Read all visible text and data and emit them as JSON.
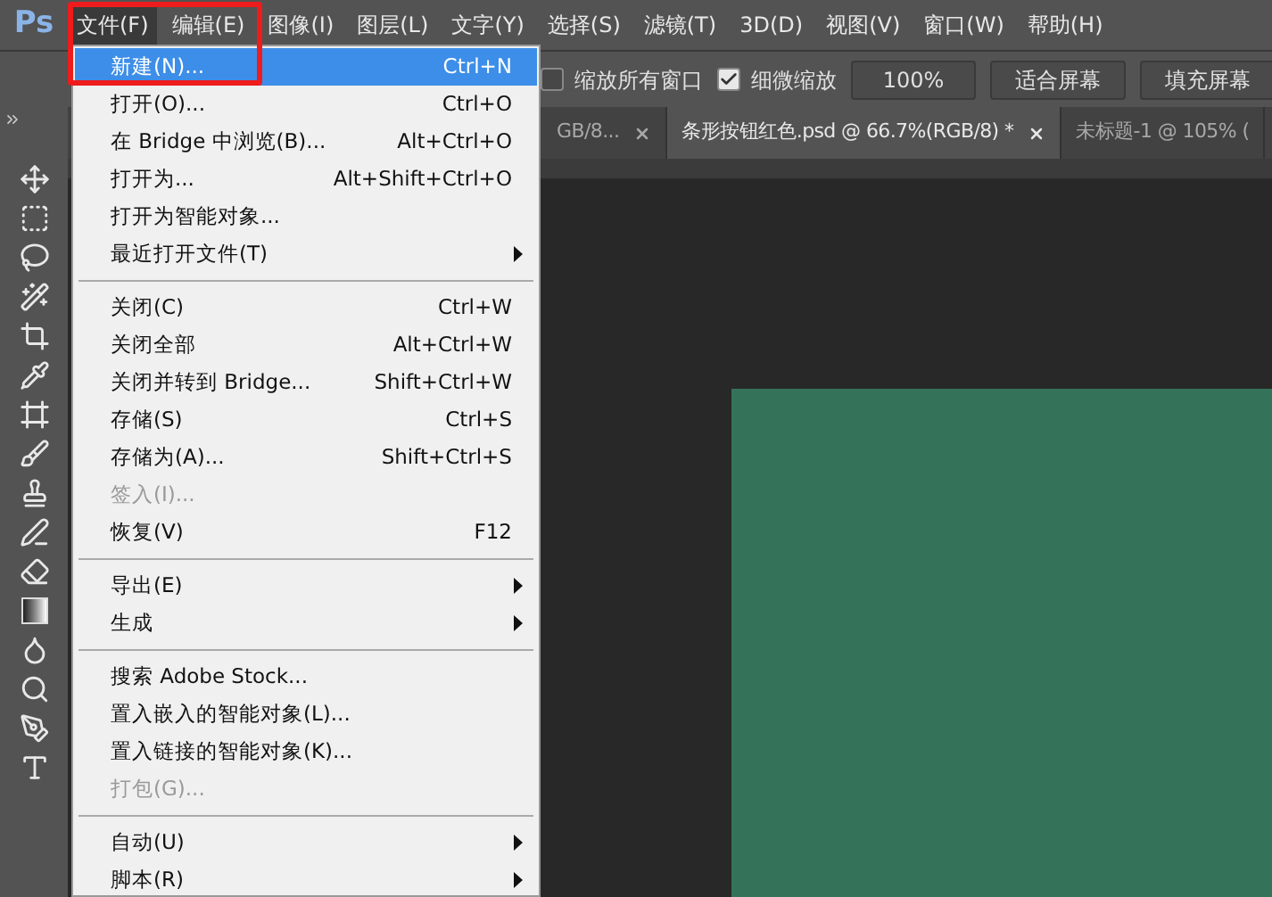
{
  "app": {
    "logo": "Ps"
  },
  "menubar": [
    {
      "label": "文件(F)",
      "selected": true
    },
    {
      "label": "编辑(E)",
      "selected": false
    },
    {
      "label": "图像(I)",
      "selected": false
    },
    {
      "label": "图层(L)",
      "selected": false
    },
    {
      "label": "文字(Y)",
      "selected": false
    },
    {
      "label": "选择(S)",
      "selected": false
    },
    {
      "label": "滤镜(T)",
      "selected": false
    },
    {
      "label": "3D(D)",
      "selected": false
    },
    {
      "label": "视图(V)",
      "selected": false
    },
    {
      "label": "窗口(W)",
      "selected": false
    },
    {
      "label": "帮助(H)",
      "selected": false
    }
  ],
  "options_bar": {
    "checkboxes": [
      {
        "label": "缩放所有窗口",
        "checked": false
      },
      {
        "label": "细微缩放",
        "checked": true
      }
    ],
    "zoom_value": "100%",
    "buttons": [
      "适合屏幕",
      "填充屏幕"
    ]
  },
  "tabs": [
    {
      "label": "GB/8...",
      "selected": false,
      "closable": true
    },
    {
      "label": "条形按钮红色.psd @ 66.7%(RGB/8) *",
      "selected": true,
      "closable": true
    },
    {
      "label": "未标题-1 @ 105% (",
      "selected": false,
      "closable": false
    }
  ],
  "file_menu": [
    [
      {
        "label": "新建(N)...",
        "shortcut": "Ctrl+N",
        "selected": true,
        "disabled": false,
        "submenu": false
      },
      {
        "label": "打开(O)...",
        "shortcut": "Ctrl+O",
        "selected": false,
        "disabled": false,
        "submenu": false
      },
      {
        "label": "在 Bridge 中浏览(B)...",
        "shortcut": "Alt+Ctrl+O",
        "selected": false,
        "disabled": false,
        "submenu": false
      },
      {
        "label": "打开为...",
        "shortcut": "Alt+Shift+Ctrl+O",
        "selected": false,
        "disabled": false,
        "submenu": false
      },
      {
        "label": "打开为智能对象...",
        "selected": false,
        "disabled": false,
        "submenu": false
      },
      {
        "label": "最近打开文件(T)",
        "selected": false,
        "disabled": false,
        "submenu": true
      }
    ],
    [
      {
        "label": "关闭(C)",
        "shortcut": "Ctrl+W",
        "selected": false,
        "disabled": false,
        "submenu": false
      },
      {
        "label": "关闭全部",
        "shortcut": "Alt+Ctrl+W",
        "selected": false,
        "disabled": false,
        "submenu": false
      },
      {
        "label": "关闭并转到 Bridge...",
        "shortcut": "Shift+Ctrl+W",
        "selected": false,
        "disabled": false,
        "submenu": false
      },
      {
        "label": "存储(S)",
        "shortcut": "Ctrl+S",
        "selected": false,
        "disabled": false,
        "submenu": false
      },
      {
        "label": "存储为(A)...",
        "shortcut": "Shift+Ctrl+S",
        "selected": false,
        "disabled": false,
        "submenu": false
      },
      {
        "label": "签入(I)...",
        "selected": false,
        "disabled": true,
        "submenu": false
      },
      {
        "label": "恢复(V)",
        "shortcut": "F12",
        "selected": false,
        "disabled": false,
        "submenu": false
      }
    ],
    [
      {
        "label": "导出(E)",
        "selected": false,
        "disabled": false,
        "submenu": true
      },
      {
        "label": "生成",
        "selected": false,
        "disabled": false,
        "submenu": true
      }
    ],
    [
      {
        "label": "搜索 Adobe Stock...",
        "selected": false,
        "disabled": false,
        "submenu": false
      },
      {
        "label": "置入嵌入的智能对象(L)...",
        "selected": false,
        "disabled": false,
        "submenu": false
      },
      {
        "label": "置入链接的智能对象(K)...",
        "selected": false,
        "disabled": false,
        "submenu": false
      },
      {
        "label": "打包(G)...",
        "selected": false,
        "disabled": true,
        "submenu": false
      }
    ],
    [
      {
        "label": "自动(U)",
        "selected": false,
        "disabled": false,
        "submenu": true
      },
      {
        "label": "脚本(R)",
        "selected": false,
        "disabled": false,
        "submenu": true
      }
    ]
  ]
}
